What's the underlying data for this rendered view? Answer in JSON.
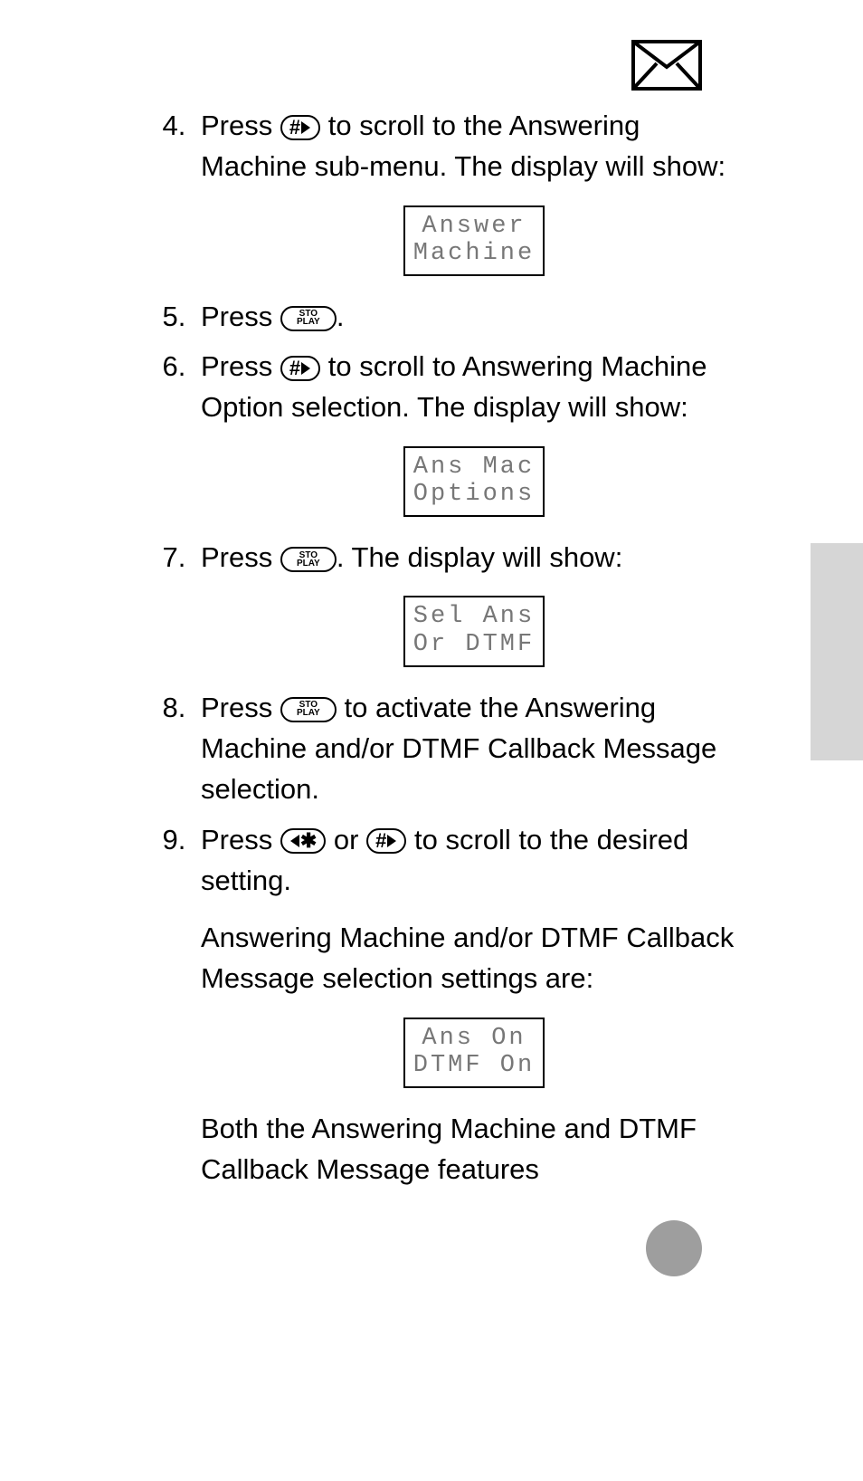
{
  "list_start": 4,
  "keys": {
    "hash": "#",
    "star": "✱",
    "sto_top": "STO",
    "sto_bot": "PLAY"
  },
  "steps": {
    "s4": {
      "pre": "Press ",
      "post": " to scroll to the Answering Machine sub-menu. The display will show:",
      "lcd": {
        "l1": "Answer",
        "l2": "Machine"
      }
    },
    "s5": {
      "pre": "Press ",
      "post": "."
    },
    "s6": {
      "pre": "Press ",
      "post": " to scroll to Answering Machine Option selection. The display will show:",
      "lcd": {
        "l1": "Ans Mac",
        "l2": "Options"
      }
    },
    "s7": {
      "pre": "Press ",
      "post": ". The display will show:",
      "lcd": {
        "l1": "Sel Ans",
        "l2": "Or DTMF"
      }
    },
    "s8": {
      "pre": "Press ",
      "post": " to activate the Answering Machine and/or DTMF Callback Message selection."
    },
    "s9": {
      "pre": "Press ",
      "mid": " or ",
      "post": " to scroll to the desired setting.",
      "para2": "Answering Machine and/or DTMF Callback Message selection settings are:",
      "lcd": {
        "l1": "Ans On",
        "l2": "DTMF On"
      },
      "para3": "Both the Answering Machine and DTMF Callback Message features"
    }
  }
}
